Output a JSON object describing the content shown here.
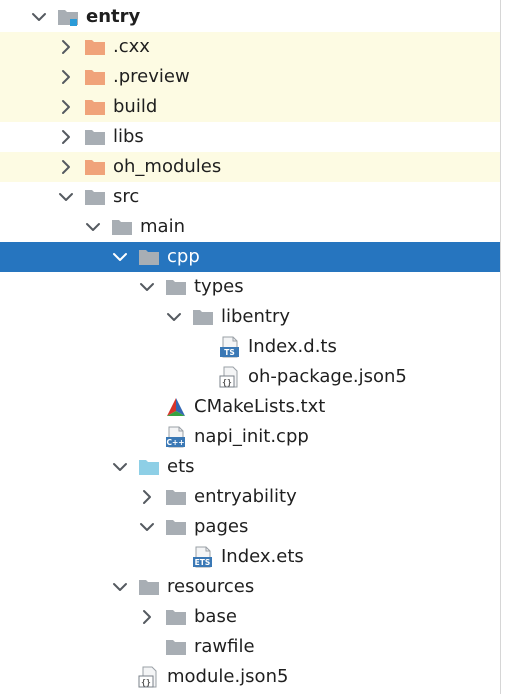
{
  "tree": [
    {
      "label": "entry",
      "icon": "module-folder-icon",
      "chevron": "down",
      "depth": 0,
      "bold": true
    },
    {
      "label": ".cxx",
      "icon": "orange-folder-icon",
      "chevron": "right",
      "depth": 1,
      "highlight": "excluded"
    },
    {
      "label": ".preview",
      "icon": "orange-folder-icon",
      "chevron": "right",
      "depth": 1,
      "highlight": "excluded"
    },
    {
      "label": "build",
      "icon": "orange-folder-icon",
      "chevron": "right",
      "depth": 1,
      "highlight": "excluded"
    },
    {
      "label": "libs",
      "icon": "gray-folder-icon",
      "chevron": "right",
      "depth": 1
    },
    {
      "label": "oh_modules",
      "icon": "orange-folder-icon",
      "chevron": "right",
      "depth": 1,
      "highlight": "excluded"
    },
    {
      "label": "src",
      "icon": "gray-folder-icon",
      "chevron": "down",
      "depth": 1
    },
    {
      "label": "main",
      "icon": "gray-folder-icon",
      "chevron": "down",
      "depth": 2
    },
    {
      "label": "cpp",
      "icon": "gray-folder-icon",
      "chevron": "down",
      "depth": 3,
      "selected": true
    },
    {
      "label": "types",
      "icon": "gray-folder-icon",
      "chevron": "down",
      "depth": 4
    },
    {
      "label": "libentry",
      "icon": "gray-folder-icon",
      "chevron": "down",
      "depth": 5
    },
    {
      "label": "Index.d.ts",
      "icon": "ts-file-icon",
      "chevron": "none",
      "depth": 6
    },
    {
      "label": "oh-package.json5",
      "icon": "json-file-icon",
      "chevron": "none",
      "depth": 6
    },
    {
      "label": "CMakeLists.txt",
      "icon": "cmake-icon",
      "chevron": "none",
      "depth": 4
    },
    {
      "label": "napi_init.cpp",
      "icon": "cpp-file-icon",
      "chevron": "none",
      "depth": 4
    },
    {
      "label": "ets",
      "icon": "blue-folder-icon",
      "chevron": "down",
      "depth": 3
    },
    {
      "label": "entryability",
      "icon": "gray-folder-icon",
      "chevron": "right",
      "depth": 4
    },
    {
      "label": "pages",
      "icon": "gray-folder-icon",
      "chevron": "down",
      "depth": 4
    },
    {
      "label": "Index.ets",
      "icon": "ets-file-icon",
      "chevron": "none",
      "depth": 5
    },
    {
      "label": "resources",
      "icon": "gray-folder-icon",
      "chevron": "down",
      "depth": 3
    },
    {
      "label": "base",
      "icon": "gray-folder-icon",
      "chevron": "right",
      "depth": 4
    },
    {
      "label": "rawfile",
      "icon": "gray-folder-icon",
      "chevron": "none",
      "depth": 4
    },
    {
      "label": "module.json5",
      "icon": "json-file-icon",
      "chevron": "none",
      "depth": 3
    }
  ],
  "colors": {
    "selected_bg": "#2675bf",
    "excluded_bg": "#fdfbe3",
    "orange_folder": "#f0a37a",
    "gray_folder": "#a8aeb4",
    "blue_folder": "#8ecfe6",
    "module_marker": "#2a9bd8"
  }
}
